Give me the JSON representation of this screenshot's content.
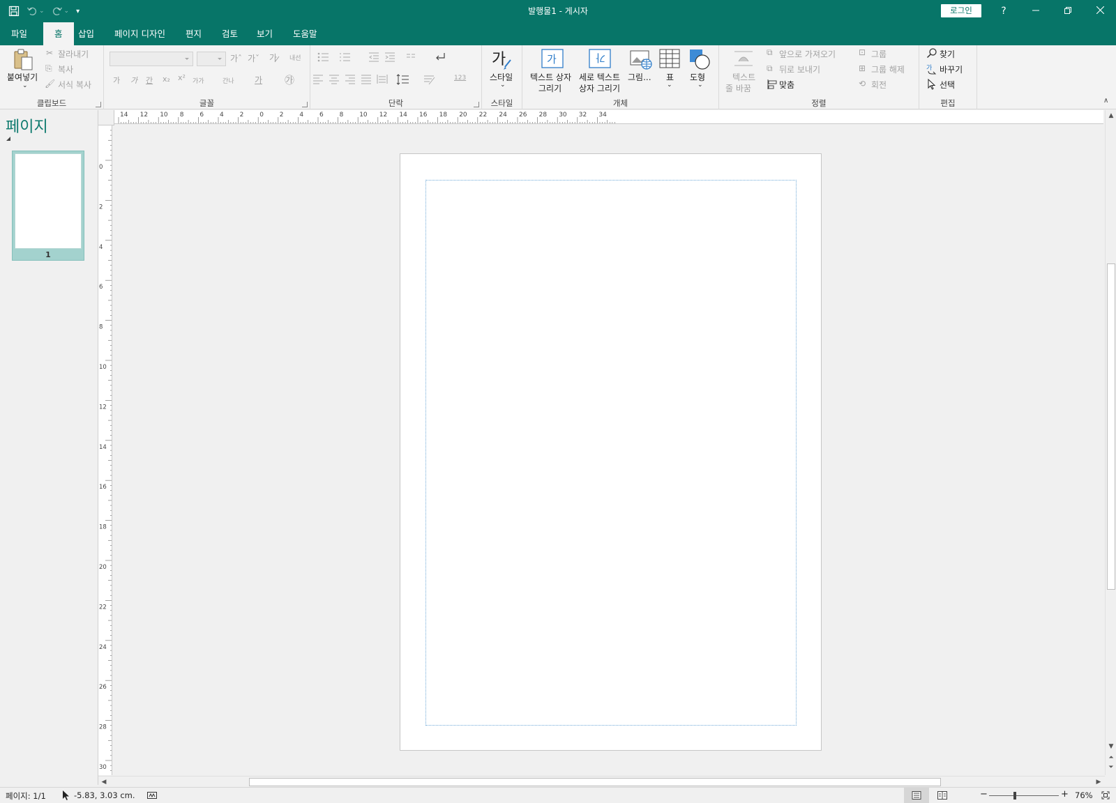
{
  "window": {
    "title": "발행물1  -  게시자",
    "login": "로그인",
    "help": "?",
    "accent": "#077568"
  },
  "quick_access": {
    "icons": [
      "save-icon",
      "undo-icon",
      "redo-icon",
      "customize-icon"
    ]
  },
  "tabs": [
    {
      "label": "파일",
      "active": false
    },
    {
      "label": "홈",
      "active": true
    },
    {
      "label": "삽입",
      "active": false
    },
    {
      "label": "페이지 디자인",
      "active": false
    },
    {
      "label": "편지",
      "active": false
    },
    {
      "label": "검토",
      "active": false
    },
    {
      "label": "보기",
      "active": false
    },
    {
      "label": "도움말",
      "active": false
    }
  ],
  "ribbon": {
    "clipboard": {
      "label": "클립보드",
      "paste": "붙여넣기",
      "cut": "잘라내기",
      "copy": "복사",
      "format_painter": "서식 복사"
    },
    "font": {
      "label": "글꼴",
      "grow": "가ˆ",
      "shrink": "가ˇ",
      "bold": "가",
      "italic": "가",
      "underline": "간",
      "subscript": "x₂",
      "superscript": "x²",
      "case": "가가",
      "spacing": "간나",
      "color": "가",
      "clear": "내선",
      "effects": "㉮"
    },
    "paragraph": {
      "label": "단락",
      "numbering": "123"
    },
    "styles": {
      "label": "스타일",
      "button": "스타일",
      "glyph": "가"
    },
    "objects": {
      "label": "개체",
      "textbox": [
        "텍스트 상자",
        "그리기"
      ],
      "vertical_textbox": [
        "세로 텍스트",
        "상자 그리기"
      ],
      "picture": "그림...",
      "table": "표",
      "shapes": "도형",
      "textbox_glyph": "가",
      "vertical_glyph": "가"
    },
    "arrange": {
      "label": "정렬",
      "wrap": [
        "텍스트",
        "줄 바꿈"
      ],
      "bring_forward": "앞으로 가져오기",
      "send_backward": "뒤로 보내기",
      "align": "맞춤",
      "group": "그룹",
      "ungroup": "그룹 해제",
      "rotate": "회전"
    },
    "editing": {
      "label": "편집",
      "find": "찾기",
      "replace": "바꾸기",
      "select": "선택"
    }
  },
  "navigation": {
    "title": "페이지",
    "pages": [
      {
        "number": "1"
      }
    ]
  },
  "rulers": {
    "horizontal_labels": [
      "14",
      "12",
      "10",
      "8",
      "6",
      "4",
      "2",
      "0",
      "2",
      "4",
      "6",
      "8",
      "10",
      "12",
      "14",
      "16",
      "18",
      "20",
      "22",
      "24",
      "26",
      "28",
      "30",
      "32",
      "34"
    ],
    "vertical_labels": [
      "0",
      "2",
      "4",
      "6",
      "8",
      "10",
      "12",
      "14",
      "16",
      "18",
      "20",
      "22",
      "24",
      "26",
      "28",
      "30"
    ]
  },
  "status": {
    "page": "페이지: 1/1",
    "position": "-5.83, 3.03 cm.",
    "zoom": "76%",
    "zoom_minus": "−",
    "zoom_plus": "+"
  }
}
